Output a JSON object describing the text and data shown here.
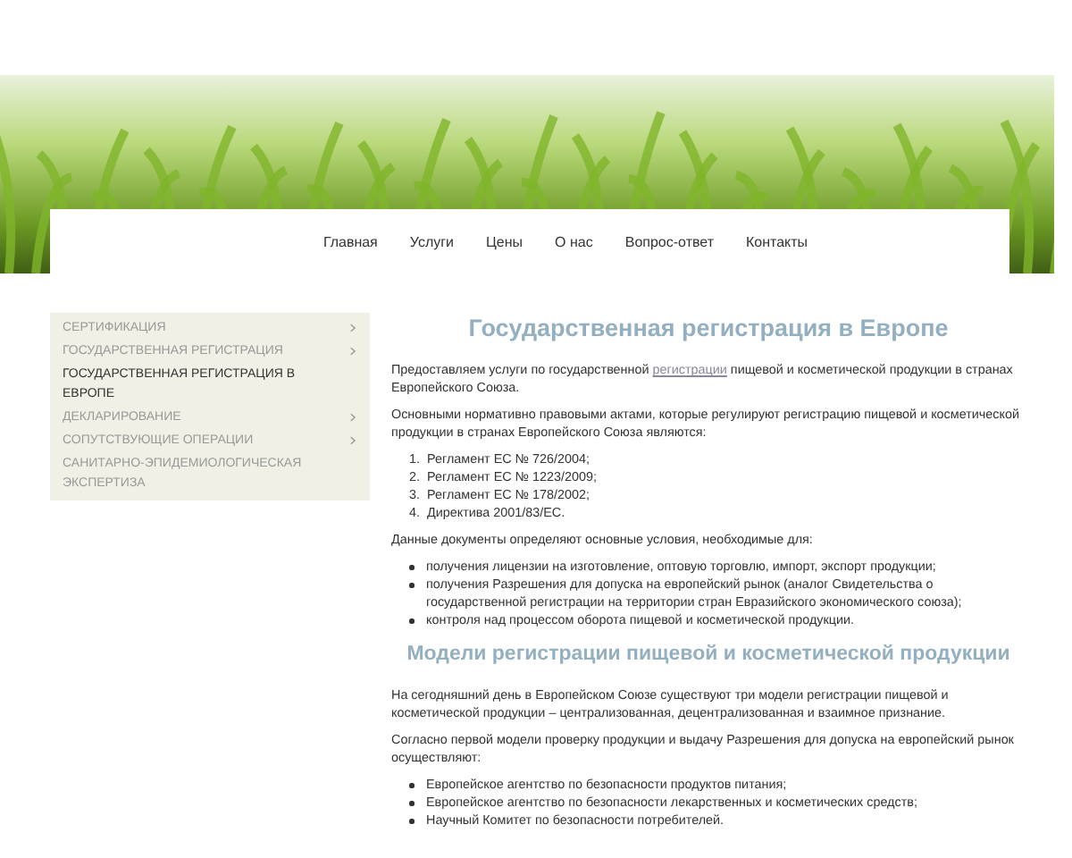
{
  "nav": {
    "items": [
      {
        "label": "Главная"
      },
      {
        "label": "Услуги"
      },
      {
        "label": "Цены"
      },
      {
        "label": "О нас"
      },
      {
        "label": "Вопрос-ответ"
      },
      {
        "label": "Контакты"
      }
    ]
  },
  "sidebar": {
    "items": [
      {
        "label": "СЕРТИФИКАЦИЯ",
        "selected": false,
        "has_submenu": true
      },
      {
        "label": "ГОСУДАРСТВЕННАЯ РЕГИСТРАЦИЯ",
        "selected": false,
        "has_submenu": true
      },
      {
        "label": "ГОСУДАРСТВЕННАЯ РЕГИСТРАЦИЯ В ЕВРОПЕ",
        "selected": true,
        "has_submenu": false
      },
      {
        "label": "ДЕКЛАРИРОВАНИЕ",
        "selected": false,
        "has_submenu": true
      },
      {
        "label": "СОПУТСТВУЮЩИЕ ОПЕРАЦИИ",
        "selected": false,
        "has_submenu": true
      },
      {
        "label": "САНИТАРНО-ЭПИДЕМИОЛОГИЧЕСКАЯ ЭКСПЕРТИЗА",
        "selected": false,
        "has_submenu": false
      }
    ]
  },
  "content": {
    "blocks": [
      {
        "kind": "heading",
        "text": "Государственная регистрация в Европе"
      },
      {
        "kind": "link_paragraph",
        "before": "Предоставляем услуги по государственной ",
        "link": "регистрации",
        "after": " пищевой и косметической продукции в странах Европейского Союза."
      },
      {
        "kind": "paragraph",
        "text": "Основными нормативно правовыми актами, которые регулируют регистрацию пищевой и косметической продукции в странах Европейского Союза являются:"
      },
      {
        "kind": "ordered_list",
        "items": [
          {
            "number": "1.",
            "text": "Регламент ЕС № 726/2004;"
          },
          {
            "number": "2.",
            "text": "Регламент ЕС № 1223/2009;"
          },
          {
            "number": "3.",
            "text": "Регламент ЕС № 178/2002;"
          },
          {
            "number": "4.",
            "text": "Директива 2001/83/ЕС."
          }
        ]
      },
      {
        "kind": "paragraph",
        "text": "Данные документы определяют основные условия, необходимые для:"
      },
      {
        "kind": "bullet_list",
        "items": [
          "получения лицензии на изготовление, оптовую торговлю, импорт, экспорт продукции;",
          "получения Разрешения для допуска на европейский рынок (аналог Свидетельства о государственной регистрации на территории стран Евразийского экономического союза);",
          "контроля над процессом оборота пищевой и косметической продукции."
        ]
      },
      {
        "kind": "subheading",
        "text": "Модели регистрации пищевой и косметической продукции"
      },
      {
        "kind": "paragraph",
        "text": "На сегодняшний день в Европейском Союзе существуют три модели регистрации пищевой и косметической продукции – централизованная, децентрализованная и взаимное признание."
      },
      {
        "kind": "paragraph",
        "text": "Согласно первой модели проверку продукции и выдачу Разрешения для допуска на европейский рынок осуществляют:"
      },
      {
        "kind": "bullet_list",
        "items": [
          "Европейское агентство по безопасности продуктов питания;",
          "Европейское агентство по безопасности лекарственных и косметических средств;",
          "Научный Комитет по безопасности потребителей."
        ]
      }
    ]
  }
}
